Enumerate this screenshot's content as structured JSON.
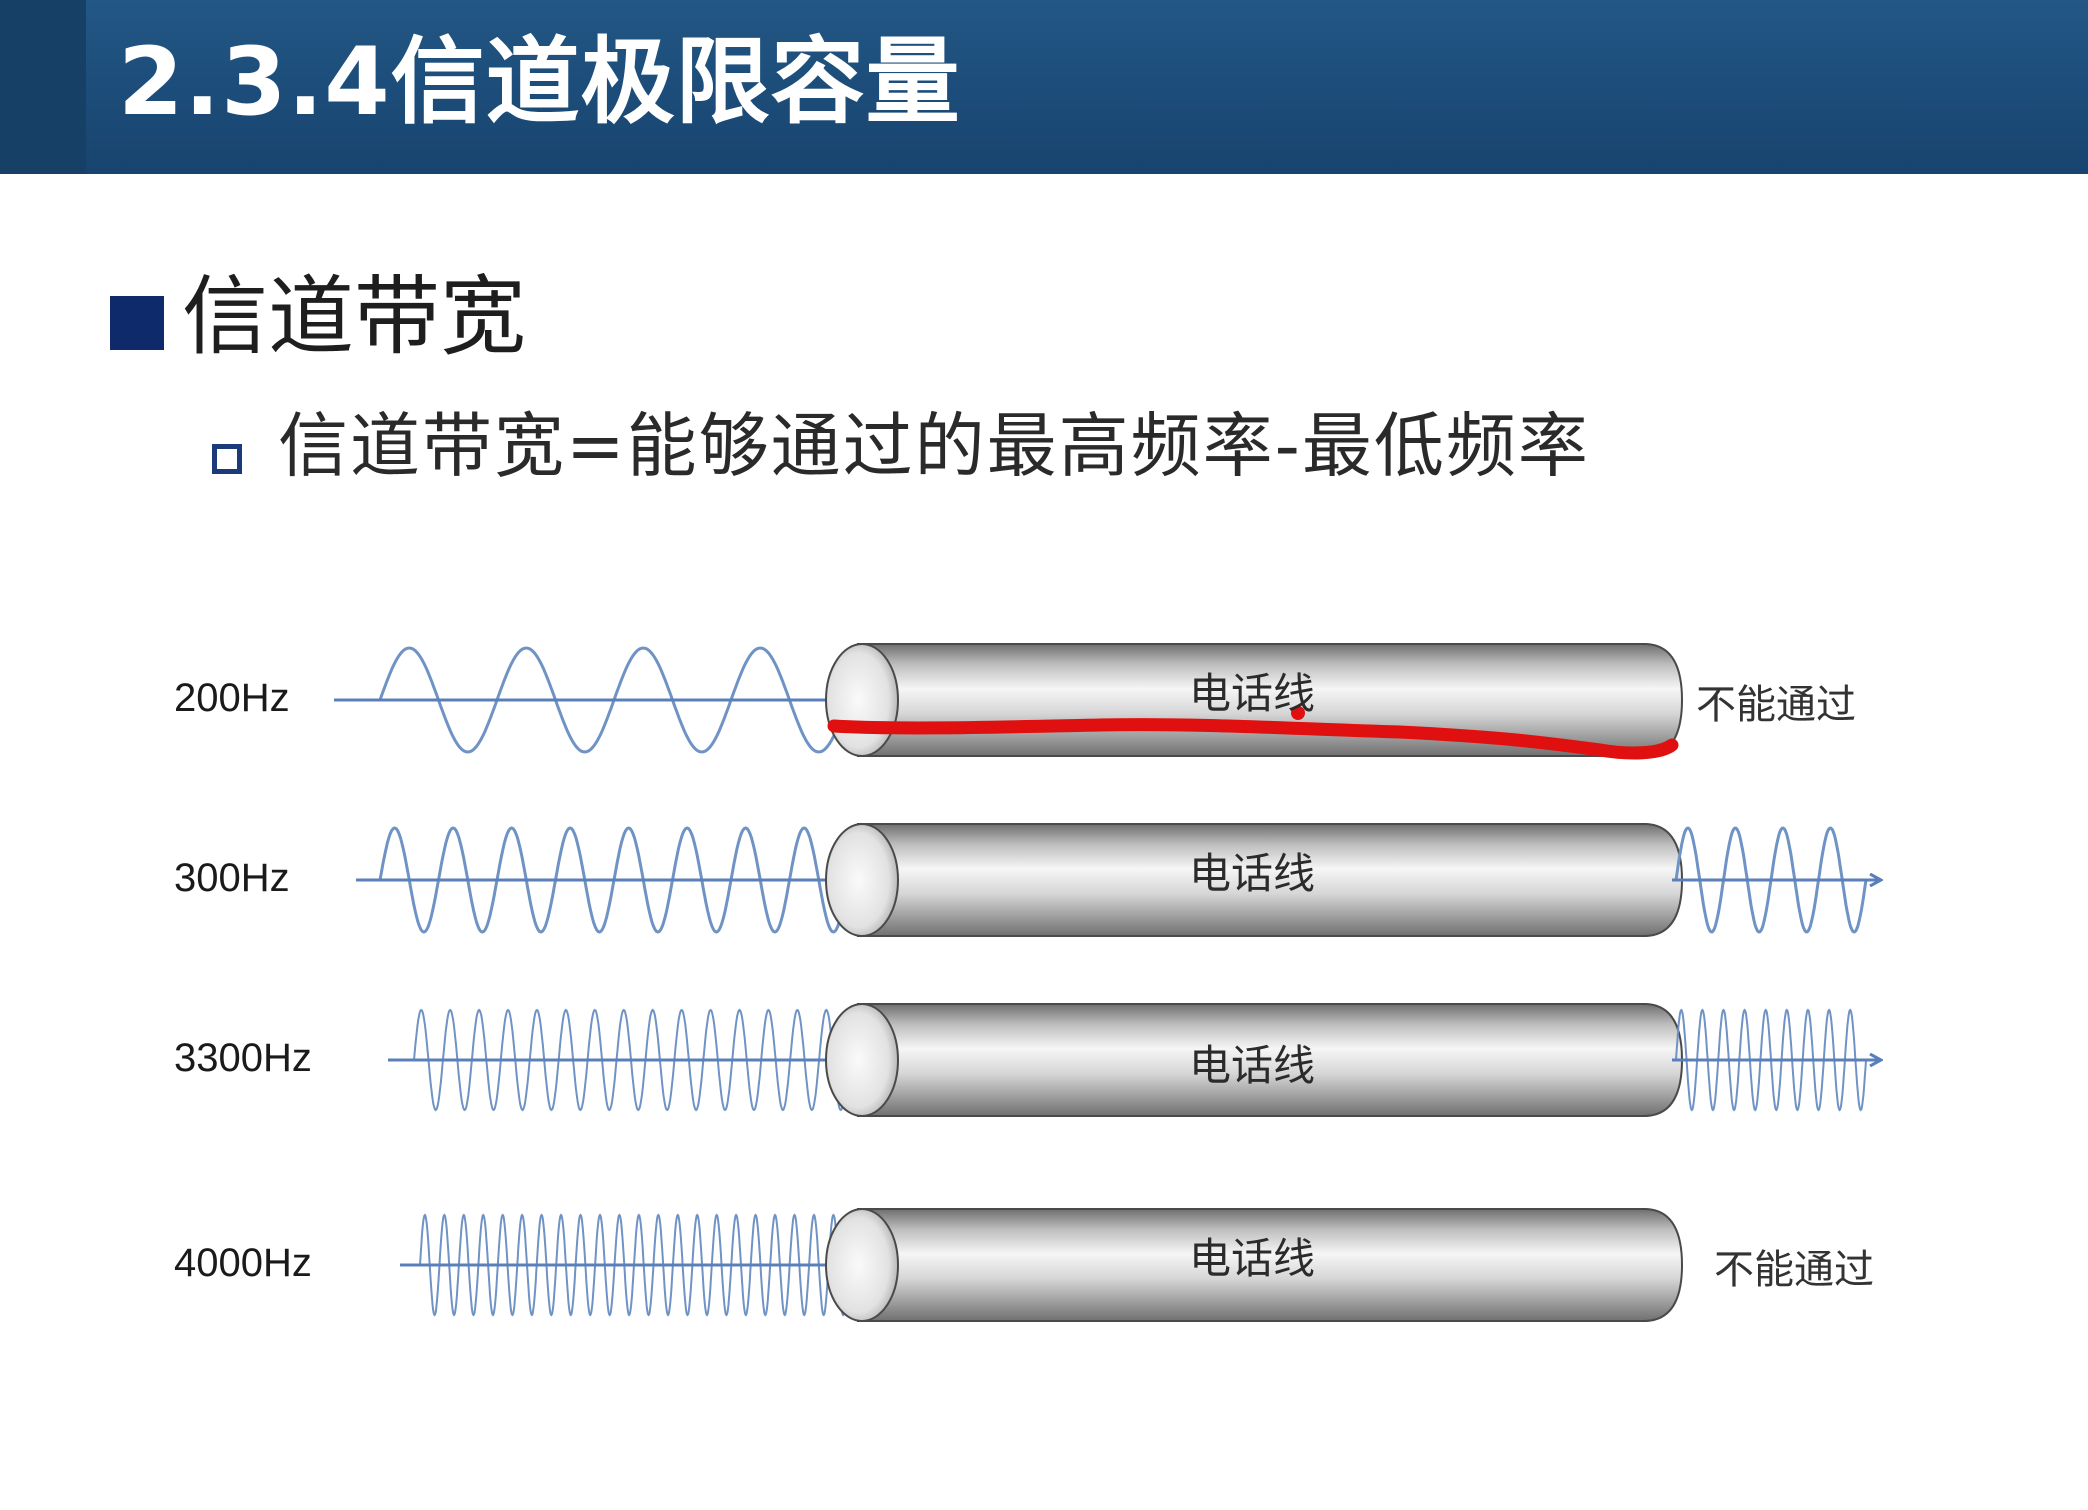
{
  "slide": {
    "title": "2.3.4信道极限容量",
    "heading": "信道带宽",
    "subtext": "信道带宽=能够通过的最高频率-最低频率"
  },
  "diagram": {
    "pipe_label": "电话线",
    "rows": [
      {
        "frequency": "200Hz",
        "passes": false,
        "result_label": "不能通过",
        "wave_density": 4
      },
      {
        "frequency": "300Hz",
        "passes": true,
        "result_label": "",
        "wave_density": 8
      },
      {
        "frequency": "3300Hz",
        "passes": true,
        "result_label": "",
        "wave_density": 15
      },
      {
        "frequency": "4000Hz",
        "passes": false,
        "result_label": "不能通过",
        "wave_density": 22
      }
    ],
    "colors": {
      "wave": "#6f93c4",
      "arrow": "#5b7fb8",
      "pipe_dark": "#5a5a5a",
      "pipe_light": "#f4f4f4",
      "annotation": "#e01010"
    }
  }
}
